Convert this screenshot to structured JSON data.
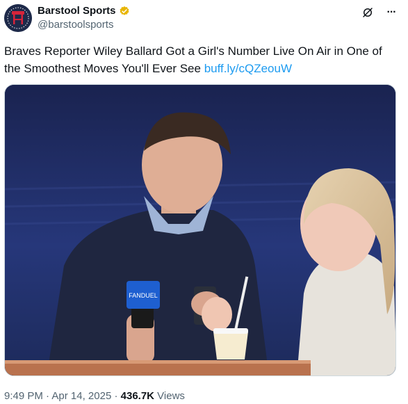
{
  "author": {
    "display_name": "Barstool Sports",
    "handle": "@barstoolsports",
    "verified_badge_color": "#e8b500",
    "avatar_icon": "barstool-logo-icon"
  },
  "top_actions": {
    "grok_icon": "grok-icon",
    "more_icon": "more-icon",
    "more_glyph": "···"
  },
  "tweet": {
    "text": "Braves Reporter Wiley Ballard Got a Girl's Number Live On Air in One of the Smoothest Moves You'll Ever See ",
    "link_text": "buff.ly/cQZeouW"
  },
  "media": {
    "type": "photo",
    "mic_flag_text": "FANDUEL"
  },
  "meta": {
    "time": "9:49 PM",
    "separator": " · ",
    "date": "Apr 14, 2025",
    "views_count": "436.7K",
    "views_label": " Views"
  },
  "colors": {
    "text": "#0f1419",
    "secondary": "#536471",
    "link": "#1d9bf0"
  }
}
